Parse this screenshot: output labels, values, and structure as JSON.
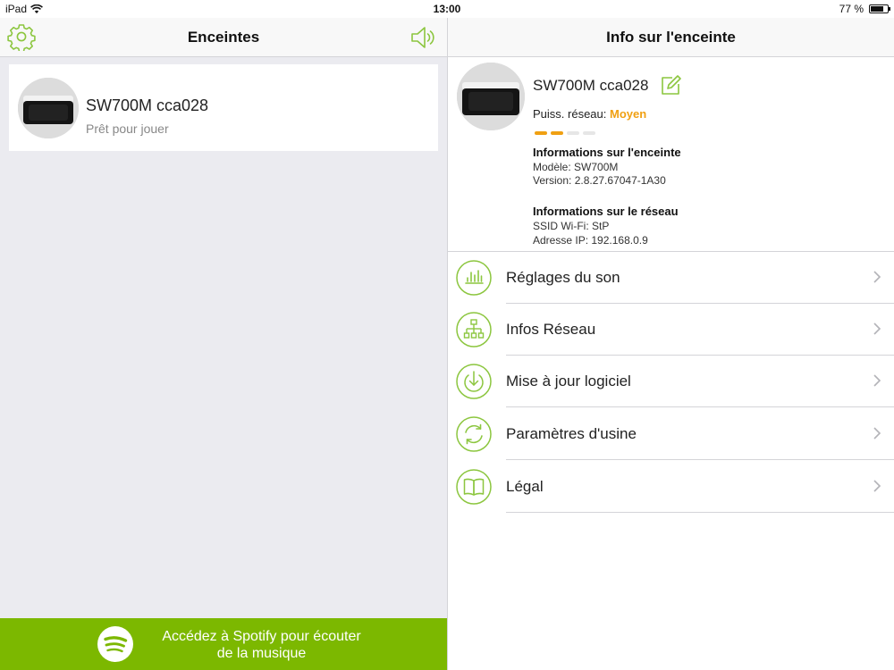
{
  "status_bar": {
    "device": "iPad",
    "time": "13:00",
    "battery": "77 %",
    "battery_level": 0.77
  },
  "left_panel": {
    "title": "Enceintes",
    "icons": {
      "settings": "gear-icon",
      "volume": "speaker-icon"
    },
    "device": {
      "name": "SW700M cca028",
      "status": "Prêt pour jouer"
    },
    "spotify_banner": {
      "line1": "Accédez à Spotify pour écouter",
      "line2": "de la musique"
    }
  },
  "right_panel": {
    "title": "Info sur l'enceinte",
    "speaker": {
      "name": "SW700M cca028",
      "signal_label": "Puiss. réseau:",
      "signal_value": "Moyen",
      "signal_level": 2,
      "signal_max": 4,
      "speaker_info_title": "Informations sur l'enceinte",
      "model": "Modèle: SW700M",
      "version": "Version: 2.8.27.67047-1A30",
      "network_info_title": "Informations sur le réseau",
      "ssid": "SSID Wi-Fi: StP",
      "ip": "Adresse IP: 192.168.0.9"
    },
    "menu": [
      {
        "label": "Réglages du son",
        "icon": "equalizer-icon"
      },
      {
        "label": "Infos Réseau",
        "icon": "network-icon"
      },
      {
        "label": "Mise à jour logiciel",
        "icon": "download-icon"
      },
      {
        "label": "Paramètres d'usine",
        "icon": "reset-icon"
      },
      {
        "label": "Légal",
        "icon": "book-icon"
      }
    ]
  },
  "colors": {
    "accent_green": "#7cb800",
    "icon_green": "#8cc63f",
    "signal_orange": "#f0a012"
  }
}
